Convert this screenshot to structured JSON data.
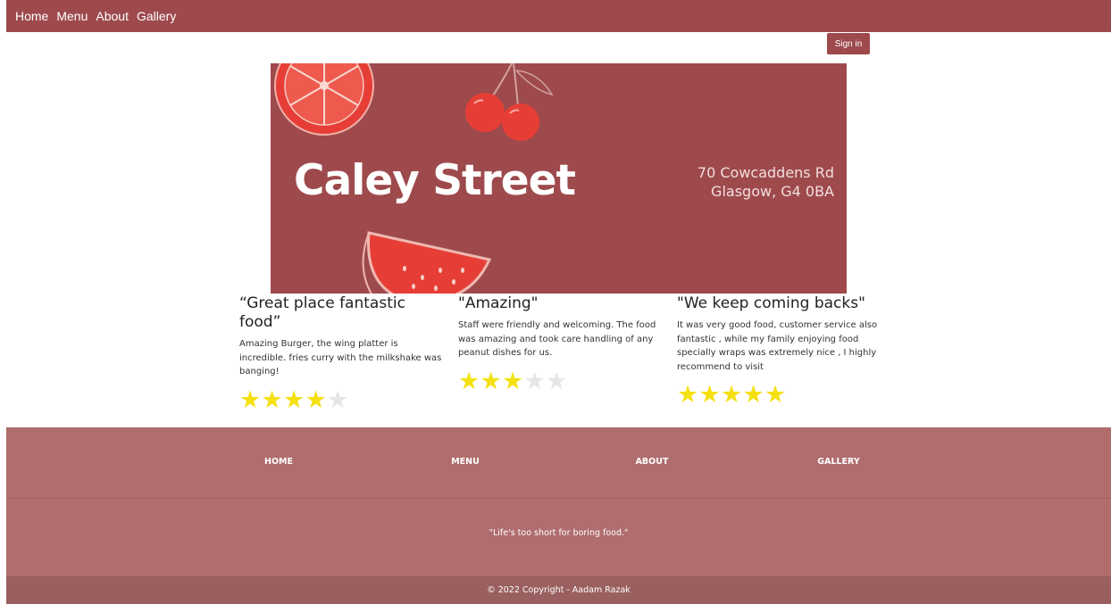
{
  "nav": {
    "items": [
      "Home",
      "Menu",
      "About",
      "Gallery"
    ],
    "sign_in": "Sign in"
  },
  "hero": {
    "title": "Caley Street",
    "address_line1": "70 Cowcaddens Rd",
    "address_line2": "Glasgow, G4 0BA",
    "decorations": [
      "orange-slice-icon",
      "cherries-icon",
      "watermelon-slice-icon"
    ]
  },
  "reviews": [
    {
      "title": "“Great place fantastic food”",
      "text": "Amazing Burger, the wing platter is incredible. fries curry with the milkshake was banging!",
      "rating": 4,
      "max": 5
    },
    {
      "title": "\"Amazing\"",
      "text": "Staff were friendly and welcoming. The food was amazing and took care handling of any peanut dishes for us.",
      "rating": 3,
      "max": 5
    },
    {
      "title": "\"We keep coming backs\"",
      "text": "It was very good food, customer service also fantastic , while my family enjoying food specially wraps was extremely nice , I highly recommend to visit",
      "rating": 5,
      "max": 5
    }
  ],
  "footer": {
    "links": [
      "HOME",
      "MENU",
      "ABOUT",
      "GALLERY"
    ],
    "quote": "\"Life's too short for boring food.\"",
    "copyright": "© 2022 Copyright - Aadam Razak"
  },
  "colors": {
    "brand": "#9e4a4d",
    "footer": "#b06d6d",
    "footer_bottom": "#9a5f5f",
    "star": "#f5e012",
    "fruit": "#e63e36"
  }
}
